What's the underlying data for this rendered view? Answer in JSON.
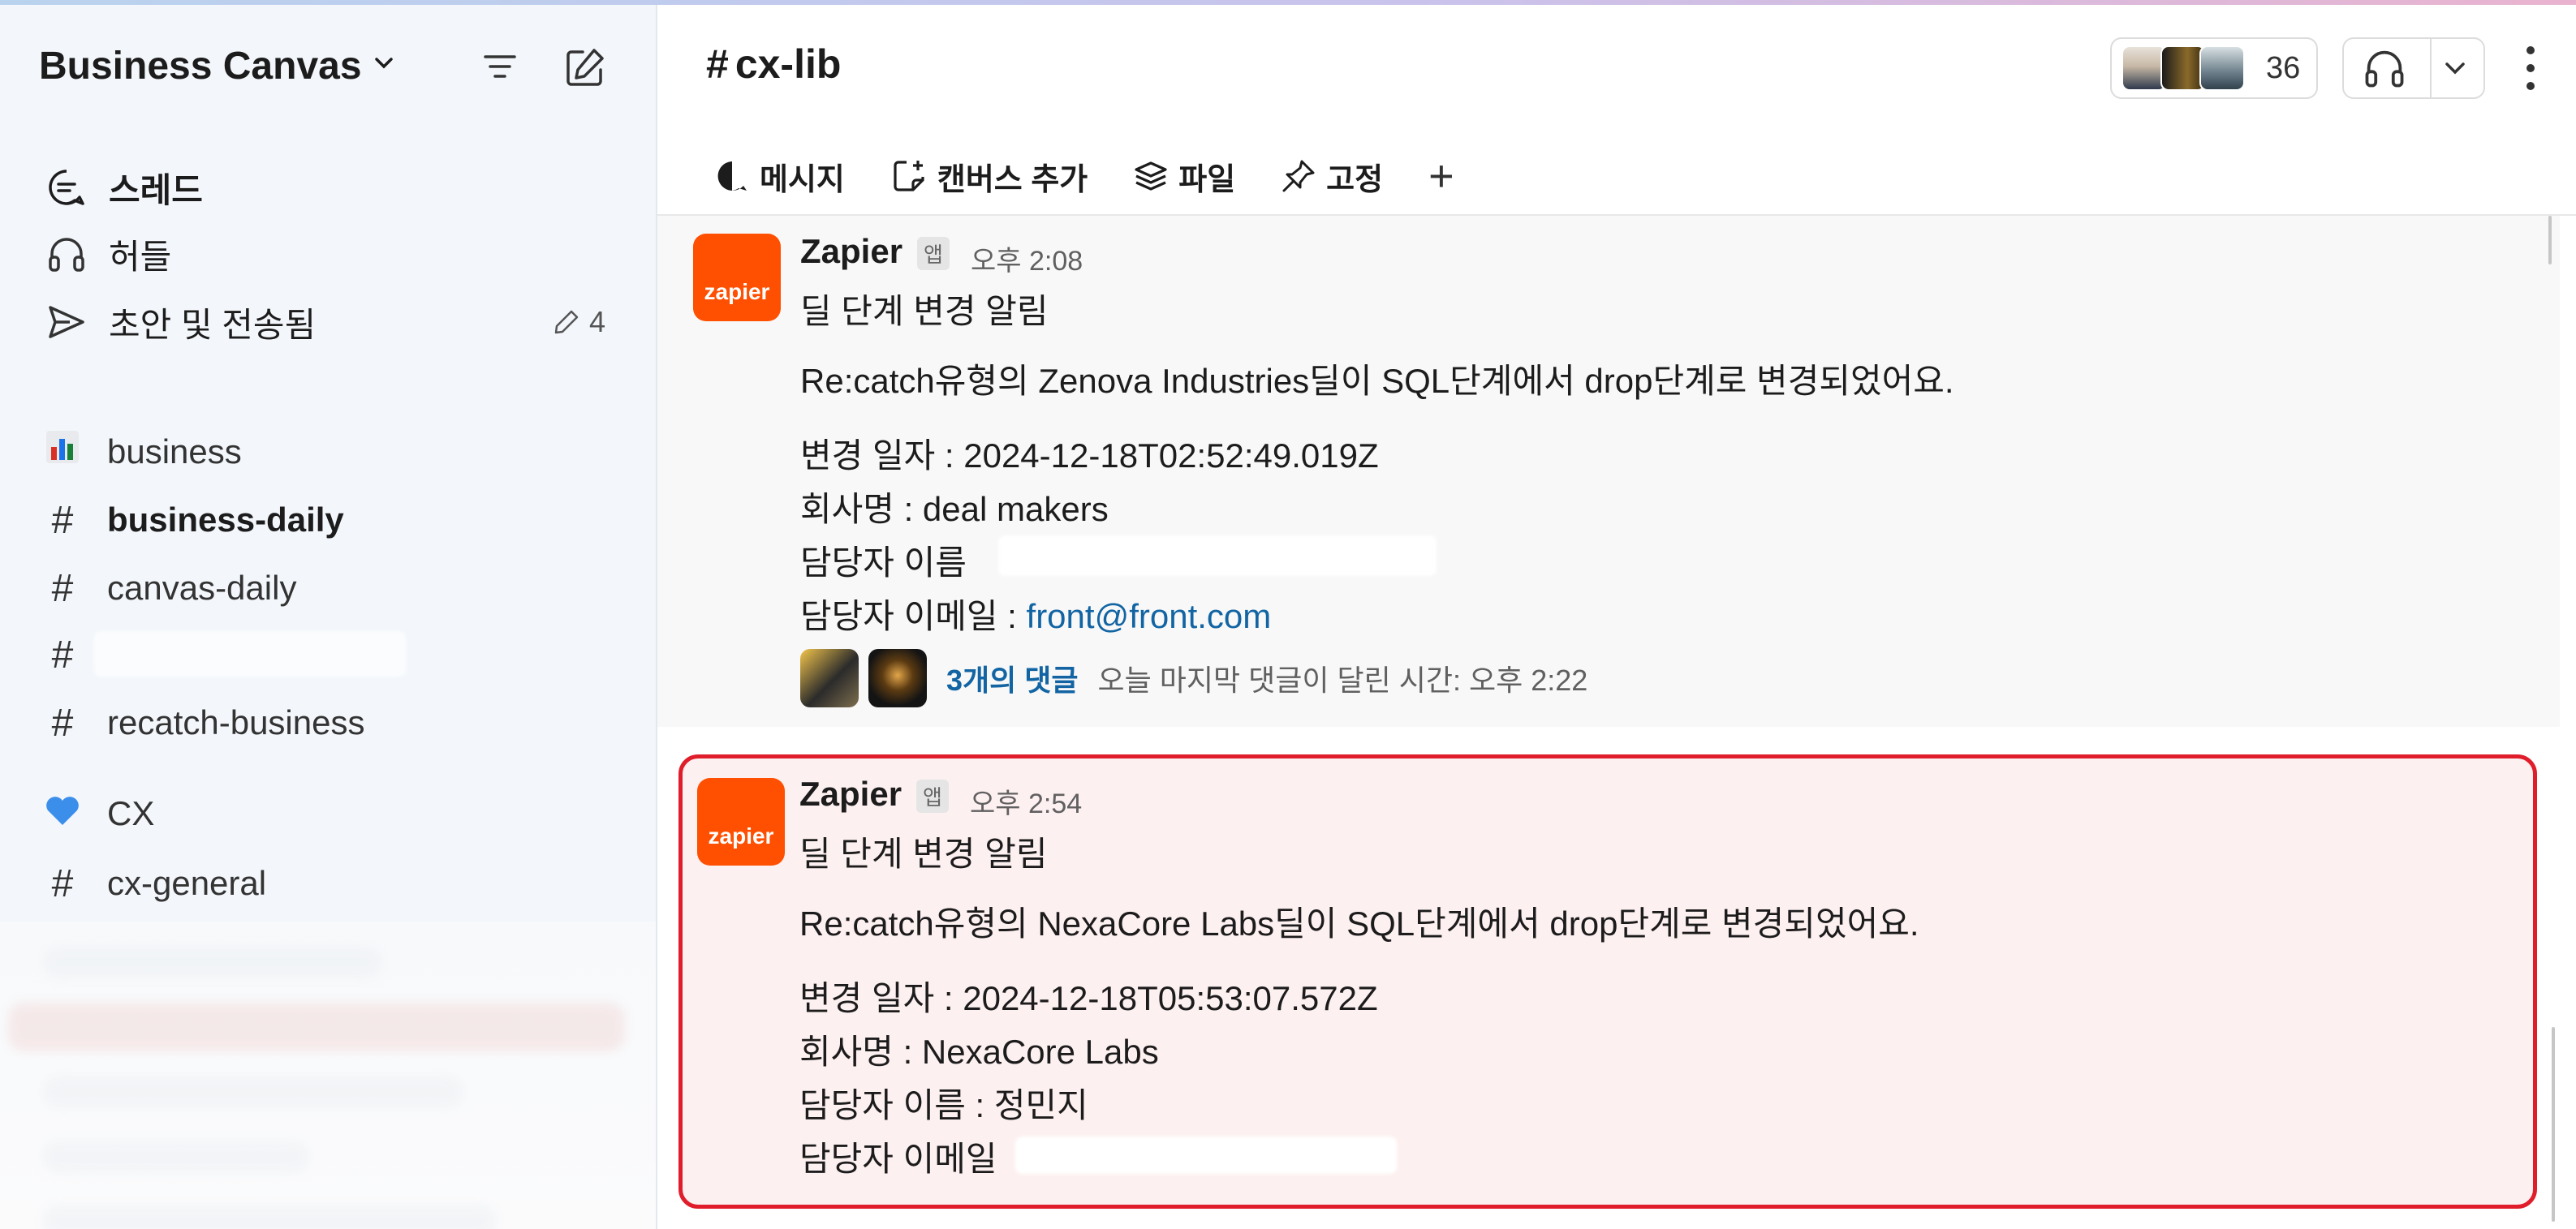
{
  "workspace": {
    "name": "Business Canvas"
  },
  "sidebar": {
    "nav": [
      {
        "label": "스레드",
        "icon": "threads-icon"
      },
      {
        "label": "허들",
        "icon": "headphones-icon"
      },
      {
        "label": "초안 및 전송됨",
        "icon": "send-icon",
        "count": "4"
      }
    ],
    "channels": [
      {
        "label": "business",
        "icon": "chart-emoji-icon"
      },
      {
        "label": "business-daily",
        "icon": "hash-icon",
        "bold": true
      },
      {
        "label": "canvas-daily",
        "icon": "hash-icon"
      },
      {
        "label": "",
        "icon": "hash-icon",
        "redacted": true
      },
      {
        "label": "recatch-business",
        "icon": "hash-icon"
      },
      {
        "label": "CX",
        "icon": "blue-heart-icon"
      },
      {
        "label": "cx-general",
        "icon": "hash-icon"
      }
    ]
  },
  "channel": {
    "name": "cx-lib",
    "member_count": "36",
    "tabs": [
      {
        "label": "메시지",
        "icon": "message-icon"
      },
      {
        "label": "캔버스 추가",
        "icon": "canvas-add-icon"
      },
      {
        "label": "파일",
        "icon": "files-icon"
      },
      {
        "label": "고정",
        "icon": "pin-icon"
      }
    ],
    "tab_add": "+"
  },
  "messages": [
    {
      "sender": "Zapier",
      "badge": "앱",
      "time": "오후 2:08",
      "logo_text": "zapier",
      "title": "딜 단계 변경 알림",
      "body": "Re:catch유형의  Zenova Industries딜이 SQL단계에서 drop단계로 변경되었어요.",
      "fields": [
        "변경 일자 : 2024-12-18T02:52:49.019Z",
        "회사명 : deal makers",
        "담당자 이름",
        "담당자 이메일 : "
      ],
      "email": "front@front.com",
      "replies": {
        "count": "3개의 댓글",
        "last": "오늘 마지막 댓글이 달린 시간: 오후 2:22"
      }
    },
    {
      "sender": "Zapier",
      "badge": "앱",
      "time": "오후 2:54",
      "logo_text": "zapier",
      "title": "딜 단계 변경 알림",
      "body": "Re:catch유형의  NexaCore Labs딜이 SQL단계에서 drop단계로 변경되었어요.",
      "fields": [
        "변경 일자 : 2024-12-18T05:53:07.572Z",
        "회사명 : NexaCore Labs",
        "담당자 이름 : 정민지",
        "담당자 이메일"
      ]
    }
  ],
  "colors": {
    "highlight_border": "#e01e2b",
    "link": "#1264a3",
    "zapier": "#ff4f00"
  }
}
